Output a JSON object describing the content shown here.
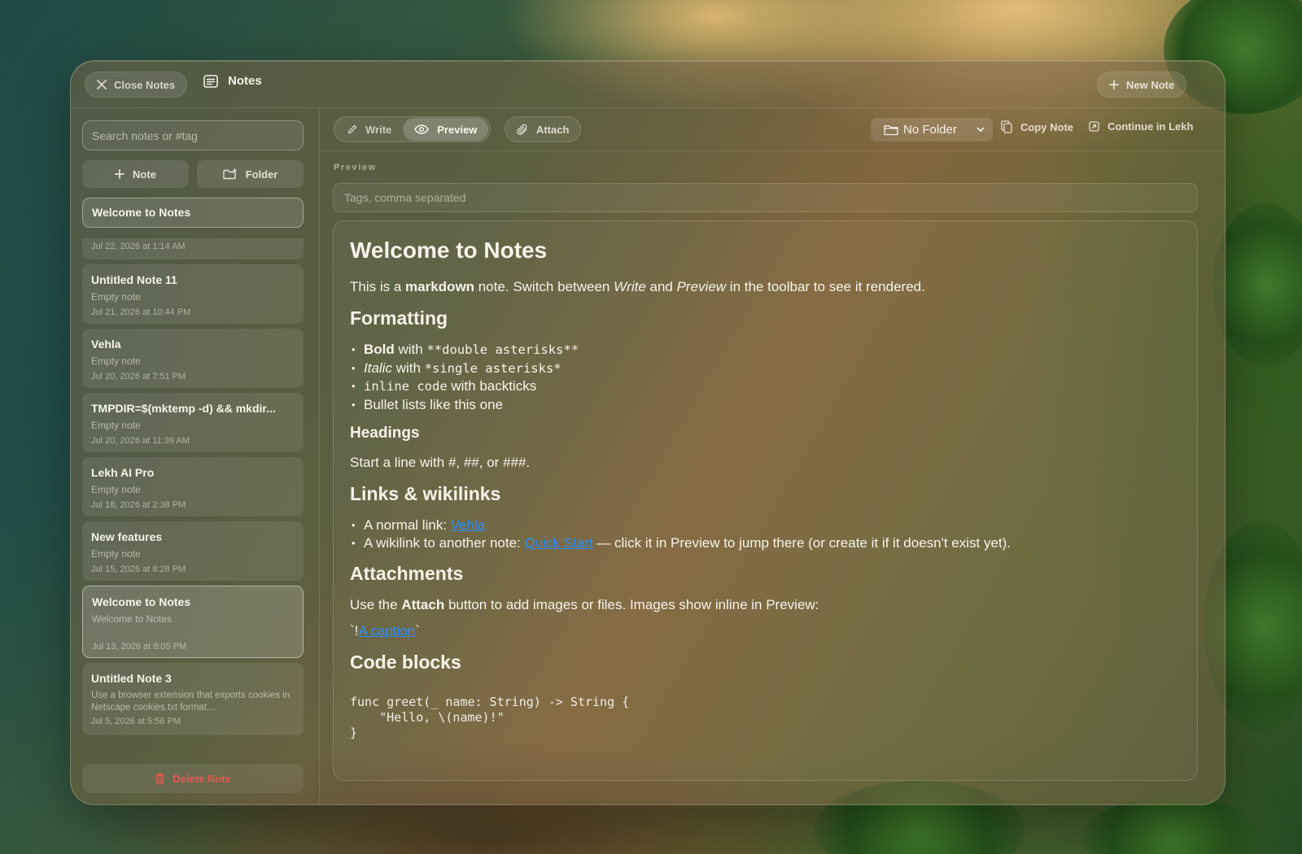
{
  "titlebar": {
    "close_label": "Close Notes",
    "title": "Notes",
    "new_note_label": "New Note"
  },
  "sidebar": {
    "search_placeholder": "Search notes or #tag",
    "note_button": "Note",
    "folder_button": "Folder",
    "header_card_title": "Welcome to Notes",
    "header_card_date": "Jul 22, 2026 at 1:14 AM",
    "notes": [
      {
        "title": "Untitled Note 11",
        "preview": "Empty note",
        "date": "Jul 21, 2026 at 10:44 PM"
      },
      {
        "title": "Vehla",
        "preview": "Empty note",
        "date": "Jul 20, 2026 at 7:51 PM"
      },
      {
        "title": "TMPDIR=$(mktemp -d) && mkdir...",
        "preview": "Empty note",
        "date": "Jul 20, 2026 at 11:39 AM"
      },
      {
        "title": "Lekh AI Pro",
        "preview": "Empty note",
        "date": "Jul 18, 2026 at 2:38 PM"
      },
      {
        "title": "New features",
        "preview": "Empty note",
        "date": "Jul 15, 2026 at 8:28 PM"
      },
      {
        "title": "Welcome to Notes",
        "preview": "Welcome to Notes",
        "date": "Jul 13, 2026 at 8:05 PM"
      },
      {
        "title": "Untitled Note 3",
        "preview": "Use a browser extension that exports cookies in Netscape cookies.txt format....",
        "date": "Jul 5, 2026 at 5:56 PM"
      }
    ],
    "delete_label": "Delete Note"
  },
  "toolbar": {
    "write_label": "Write",
    "preview_label": "Preview",
    "attach_label": "Attach",
    "folder_value": "No Folder",
    "copy_label": "Copy Note",
    "continue_label": "Continue in Lekh"
  },
  "editor": {
    "section_label": "Preview",
    "tags_placeholder": "Tags, comma separated"
  },
  "doc": {
    "h1": "Welcome to Notes",
    "intro": {
      "a": "This is a ",
      "b": "markdown",
      "c": " note. Switch between ",
      "d": "Write",
      "e": " and ",
      "f": "Preview",
      "g": " in the toolbar to see it rendered."
    },
    "h_formatting": "Formatting",
    "fmt": {
      "bold": "Bold",
      "with1": " with ",
      "bold_code": "**double asterisks**",
      "italic": "Italic",
      "with2": " with ",
      "italic_code": "*single asterisks*",
      "inline_code": "inline code",
      "with3": " with backticks",
      "bullets": "Bullet lists like this one"
    },
    "h_headings": "Headings",
    "headings_text": "Start a line with #, ##, or ###.",
    "h_links": "Links & wikilinks",
    "links": {
      "normal_prefix": "A normal link: ",
      "normal_link": "Vehla",
      "wiki_prefix": "A wikilink to another note: ",
      "wiki_link": "Quick Start",
      "wiki_suffix": " — click it in Preview to jump there (or create it if it doesn't exist yet)."
    },
    "h_attachments": "Attachments",
    "attach": {
      "a": "Use the ",
      "b": "Attach",
      "c": " button to add images or files. Images show inline in Preview:"
    },
    "caption": {
      "pre": "`!",
      "link": "A caption",
      "post": "`"
    },
    "h_code": "Code blocks",
    "code": "func greet(_ name: String) -> String {\n    \"Hello, \\(name)!\"\n}"
  },
  "colors": {
    "link": "#2f8df5",
    "danger": "#e05b4e"
  }
}
